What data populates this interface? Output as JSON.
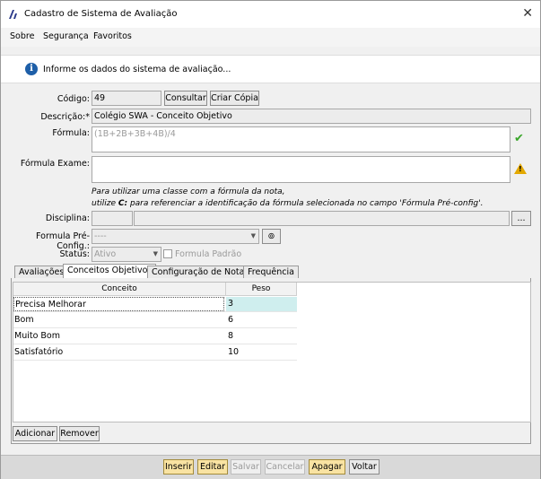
{
  "window": {
    "title": "Cadastro de Sistema de Avaliação",
    "close_glyph": "✕"
  },
  "menu": {
    "items": [
      "Sobre",
      "Segurança",
      "Favoritos"
    ]
  },
  "info": {
    "text": "Informe os dados do sistema de avaliação...",
    "icon": "info-icon"
  },
  "form": {
    "codigo_label": "Código:",
    "codigo_value": "49",
    "consultar_label": "Consultar",
    "criar_copia_label": "Criar Cópia",
    "descricao_label": "Descrição:*",
    "descricao_value": "Colégio SWA - Conceito Objetivo",
    "formula_label": "Fórmula:",
    "formula_value": "(1B+2B+3B+4B)/4",
    "formula_exame_label": "Fórmula Exame:",
    "formula_exame_value": "",
    "hint_line1": "Para utilizar uma classe com a fórmula da nota,",
    "hint_line2_prefix": "utilize ",
    "hint_line2_bold": "C:",
    "hint_line2_suffix": " para referenciar a identificação da fórmula selecionada no campo 'Fórmula Pré-config'.",
    "disciplina_label": "Disciplina:",
    "disciplina_code": "",
    "disciplina_name": "",
    "disciplina_browse": "...",
    "pre_config_label": "Formula Pré-Config.:",
    "pre_config_value": "----",
    "status_label": "Status:",
    "status_value": "Ativo",
    "formula_padrao_label": "Formula Padrão"
  },
  "tabs": [
    {
      "label": "Avaliações",
      "active": false
    },
    {
      "label": "Conceitos Objetivos",
      "active": true
    },
    {
      "label": "Configuração de Notas",
      "active": false
    },
    {
      "label": "Frequência",
      "active": false
    }
  ],
  "grid": {
    "columns": [
      "Conceito",
      "Peso"
    ],
    "rows": [
      {
        "conceito": "Precisa Melhorar",
        "peso": "3",
        "selected": true
      },
      {
        "conceito": "Bom",
        "peso": "6",
        "selected": false
      },
      {
        "conceito": "Muito Bom",
        "peso": "8",
        "selected": false
      },
      {
        "conceito": "Satisfatório",
        "peso": "10",
        "selected": false
      }
    ]
  },
  "grid_buttons": {
    "adicionar": "Adicionar",
    "remover": "Remover"
  },
  "footer": {
    "inserir": "Inserir",
    "editar": "Editar",
    "salvar": "Salvar",
    "cancelar": "Cancelar",
    "apagar": "Apagar",
    "voltar": "Voltar"
  },
  "colors": {
    "accent_yellow": "#f9e3a2",
    "selected_row": "#cfeeee",
    "info_blue": "#1e5fa8",
    "ok_green": "#3aa62a",
    "warn_amber": "#e3a800"
  }
}
